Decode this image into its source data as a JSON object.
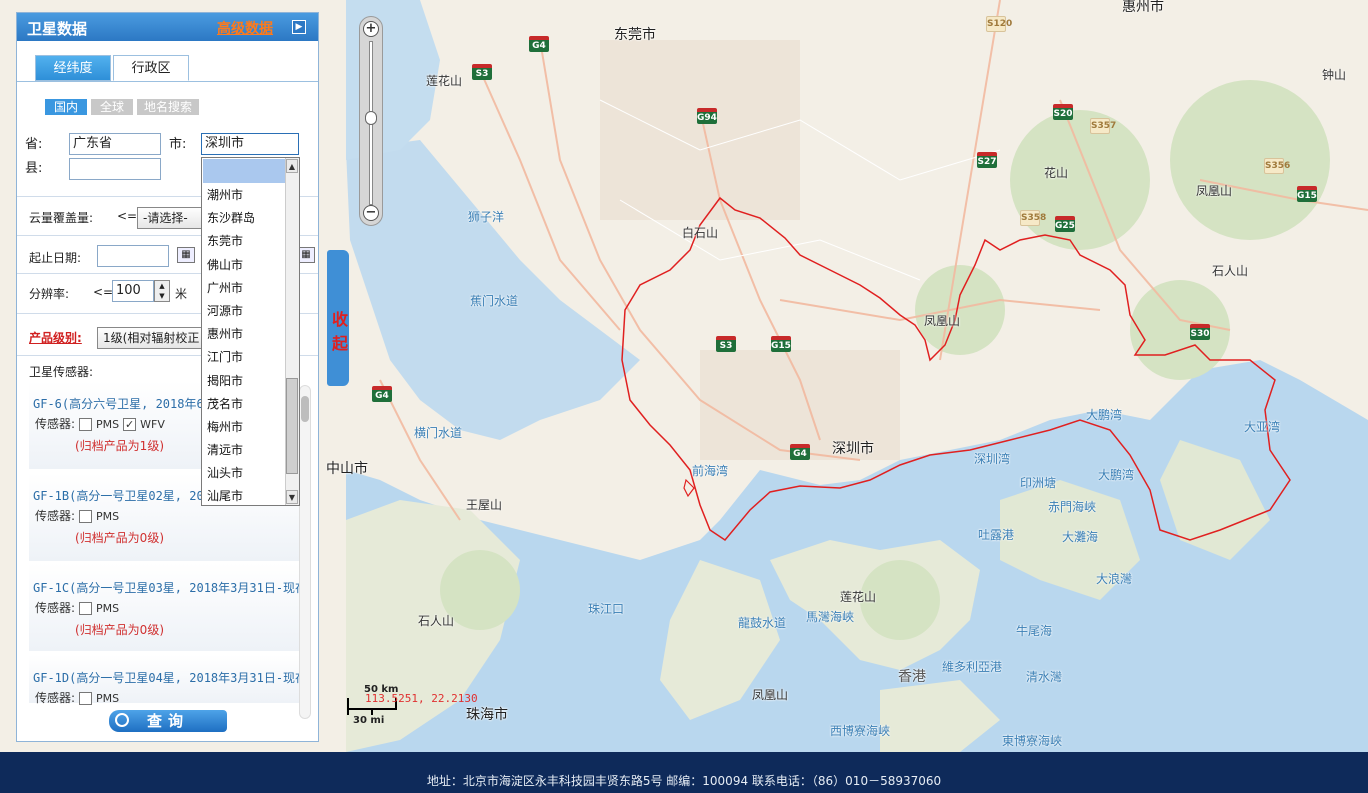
{
  "panel": {
    "title": "卫星数据",
    "header_link": "高级数据",
    "tabs": {
      "active": "经纬度",
      "other": "行政区"
    },
    "subtabs": [
      "国内",
      "全球",
      "地名搜索"
    ],
    "fields": {
      "province_label": "省:",
      "province_value": "广东省",
      "city_label": "市:",
      "city_value": "深圳市",
      "county_label": "县:",
      "county_value": ""
    },
    "cloud_label": "云量覆盖量:",
    "cloud_op": "<=",
    "cloud_select": "-请选择-",
    "date_label": "起止日期:",
    "res_label": "分辨率:",
    "res_op": "<=",
    "res_value": "100",
    "res_unit": "米",
    "level_label": "产品级别:",
    "level_select": "1级(相对辐射校正",
    "sat_section_title": "卫星传感器:",
    "satellites": [
      {
        "name": "GF-6(高分六号卫星, 2018年6月",
        "sensor_label": "传感器:",
        "sensors": [
          "PMS",
          "WFV"
        ],
        "checked": [
          "WFV"
        ],
        "note": "(归档产品为1级)"
      },
      {
        "name": "GF-1B(高分一号卫星02星, 2018",
        "sensor_label": "传感器:",
        "sensors": [
          "PMS"
        ],
        "checked": [],
        "note": "(归档产品为0级)"
      },
      {
        "name": "GF-1C(高分一号卫星03星, 2018年3月31日-现在",
        "sensor_label": "传感器:",
        "sensors": [
          "PMS"
        ],
        "checked": [],
        "note": "(归档产品为0级)"
      },
      {
        "name": "GF-1D(高分一号卫星04星, 2018年3月31日-现在",
        "sensor_label": "传感器:",
        "sensors": [
          "PMS"
        ],
        "checked": [],
        "note": ""
      }
    ],
    "query_button": "查询"
  },
  "dropdown": {
    "options": [
      "潮州市",
      "东沙群岛",
      "东莞市",
      "佛山市",
      "广州市",
      "河源市",
      "惠州市",
      "江门市",
      "揭阳市",
      "茂名市",
      "梅州市",
      "清远市",
      "汕头市",
      "汕尾市"
    ]
  },
  "collapse_label": "收起",
  "map": {
    "labels": {
      "dongguan": "东莞市",
      "huizhou": "惠州市",
      "shenzhen": "深圳市",
      "hongkong": "香港",
      "zhuhai": "珠海市",
      "zhongshan": "中山市",
      "lotus1": "莲花山",
      "lotus2": "莲花山",
      "baishishan": "白石山",
      "fenghuangshan1": "凤凰山",
      "fenghuangshan2": "凤凰山",
      "fenghuangshan3": "凤凰山",
      "huashan": "花山",
      "zhongshan2": "钟山",
      "shirenshan": "石人山",
      "wangwushan": "王屋山",
      "shijiaoshan": "石人山",
      "shiziyang": "狮子洋",
      "jiaomen": "蕉门水道",
      "hengmen": "横门水道",
      "qianhai": "前海湾",
      "shenzhenwan": "深圳湾",
      "dapeng1": "大鹏湾",
      "dapeng2": "大鹏湾",
      "daya": "大亚湾",
      "yinzhou": "印洲塘",
      "chimen": "赤門海峽",
      "tolo": "吐露港",
      "datan": "大灘海",
      "dalang": "大浪灣",
      "zhujiangkou": "珠江口",
      "lingding": "龍鼓水道",
      "mawan": "馬灣海峽",
      "niutou": "牛尾海",
      "qingshui": "清水灣",
      "victoria": "維多利亞港",
      "xibo": "西博寮海峽",
      "dongbo": "東博寮海峽"
    },
    "shields": [
      "G4",
      "S3",
      "G94",
      "S120",
      "S20",
      "S357",
      "S27",
      "S356",
      "G15",
      "S358",
      "G25",
      "S30",
      "S3",
      "G15",
      "G4",
      "G4"
    ],
    "scale_km": "50 km",
    "scale_mi": "30 mi",
    "coords": "113.5251, 22.2130"
  },
  "footer": {
    "text": "地址：北京市海淀区永丰科技园丰贤东路5号    邮编：100094    联系电话：（86）010－58937060"
  }
}
